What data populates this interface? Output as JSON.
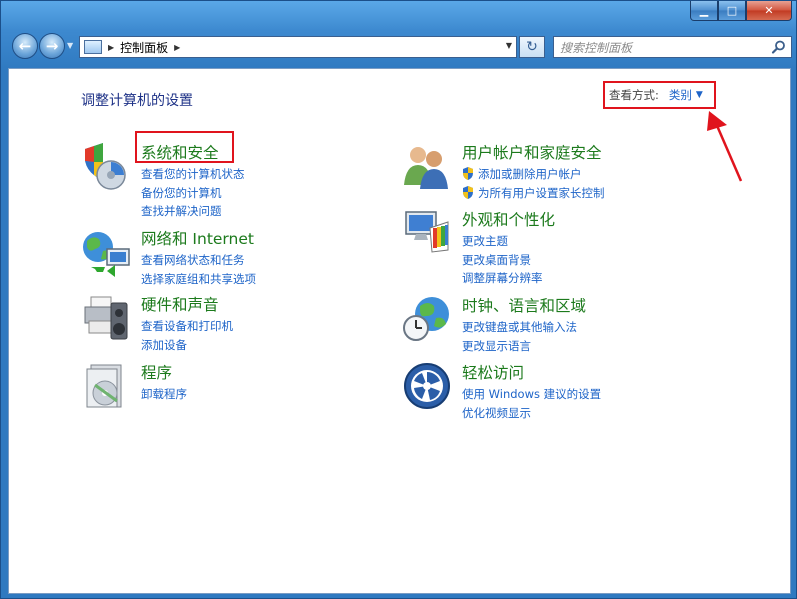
{
  "window": {
    "minimize": "▁",
    "maximize": "□",
    "close": "✕"
  },
  "nav": {
    "back_glyph": "←",
    "forward_glyph": "→",
    "breadcrumb": "控制面板",
    "refresh_glyph": "↻",
    "search_placeholder": "搜索控制面板"
  },
  "page": {
    "heading": "调整计算机的设置",
    "view_by_label": "查看方式:",
    "view_by_value": "类别",
    "accent_color": "#e0141d"
  },
  "categories_left": [
    {
      "title": "系统和安全",
      "icon": "system-security-icon",
      "links": [
        "查看您的计算机状态",
        "备份您的计算机",
        "查找并解决问题"
      ]
    },
    {
      "title": "网络和 Internet",
      "icon": "network-internet-icon",
      "links": [
        "查看网络状态和任务",
        "选择家庭组和共享选项"
      ]
    },
    {
      "title": "硬件和声音",
      "icon": "hardware-sound-icon",
      "links": [
        "查看设备和打印机",
        "添加设备"
      ]
    },
    {
      "title": "程序",
      "icon": "programs-icon",
      "links": [
        "卸载程序"
      ]
    }
  ],
  "categories_right": [
    {
      "title": "用户帐户和家庭安全",
      "icon": "user-accounts-icon",
      "links": [
        "添加或删除用户帐户",
        "为所有用户设置家长控制"
      ]
    },
    {
      "title": "外观和个性化",
      "icon": "appearance-icon",
      "links": [
        "更改主题",
        "更改桌面背景",
        "调整屏幕分辨率"
      ]
    },
    {
      "title": "时钟、语言和区域",
      "icon": "clock-language-icon",
      "links": [
        "更改键盘或其他输入法",
        "更改显示语言"
      ]
    },
    {
      "title": "轻松访问",
      "icon": "ease-of-access-icon",
      "links": [
        "使用 Windows 建议的设置",
        "优化视频显示"
      ]
    }
  ]
}
